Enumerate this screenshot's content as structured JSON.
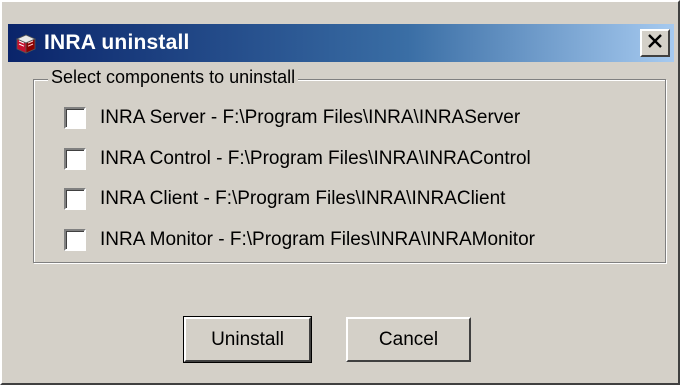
{
  "window": {
    "title": "INRA uninstall",
    "close_symbol": "×"
  },
  "icons": {
    "app": "uninstall-box-icon",
    "close": "close-icon"
  },
  "group": {
    "label": "Select components to uninstall",
    "options": [
      {
        "label": "INRA Server - F:\\Program Files\\INRA\\INRAServer",
        "checked": false
      },
      {
        "label": "INRA Control - F:\\Program Files\\INRA\\INRAControl",
        "checked": false
      },
      {
        "label": "INRA Client - F:\\Program Files\\INRA\\INRAClient",
        "checked": false
      },
      {
        "label": "INRA Monitor - F:\\Program Files\\INRA\\INRAMonitor",
        "checked": false
      }
    ]
  },
  "buttons": {
    "uninstall": "Uninstall",
    "cancel": "Cancel"
  },
  "colors": {
    "titlebar_start": "#0a246a",
    "titlebar_end": "#a6caf0",
    "face": "#d4d0c8"
  }
}
